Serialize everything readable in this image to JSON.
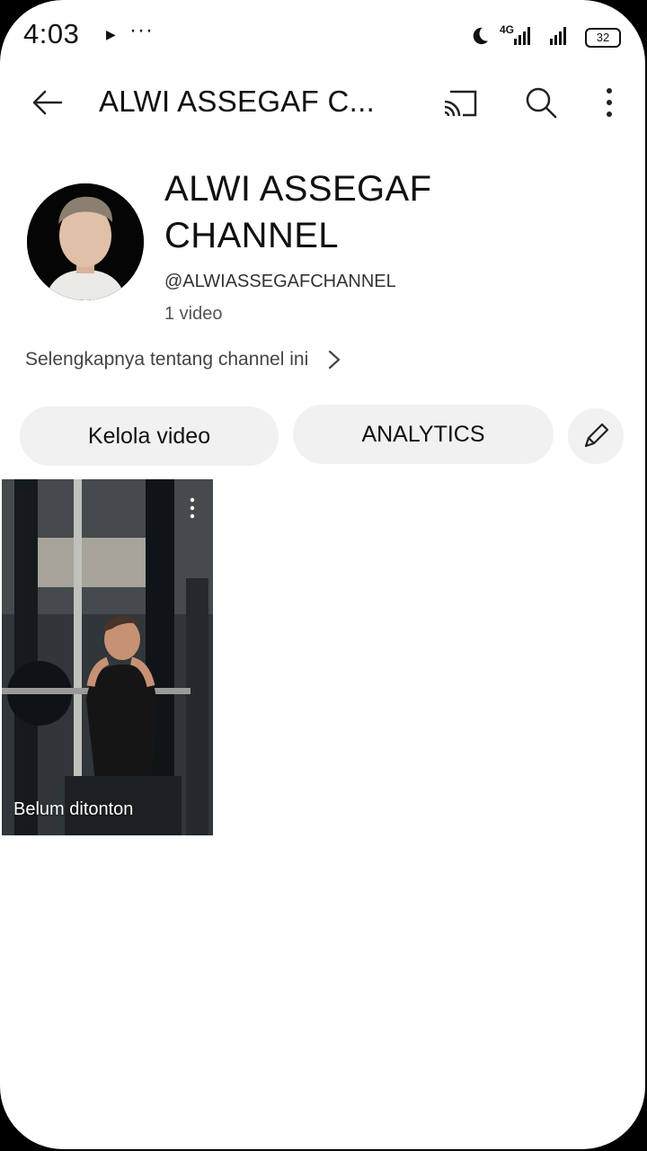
{
  "status": {
    "time": "4:03",
    "play_icon": "▶",
    "more_dots": "···",
    "network": "4G",
    "battery": "32"
  },
  "appbar": {
    "title": "ALWI ASSEGAF C..."
  },
  "channel": {
    "name": "ALWI ASSEGAF CHANNEL",
    "handle": "@ALWIASSEGAFCHANNEL",
    "video_count": "1 video",
    "about_link": "Selengkapnya tentang channel ini"
  },
  "actions": {
    "manage": "Kelola video",
    "analytics": "ANALYTICS"
  },
  "video": {
    "label": "Belum ditonton"
  },
  "icons": [
    "back-icon",
    "cast-icon",
    "search-icon",
    "more-vert-icon",
    "chevron-right-icon",
    "pencil-icon"
  ],
  "colors": {
    "background": "#ffffff",
    "button": "#f1f1f1",
    "text": "#111111"
  }
}
